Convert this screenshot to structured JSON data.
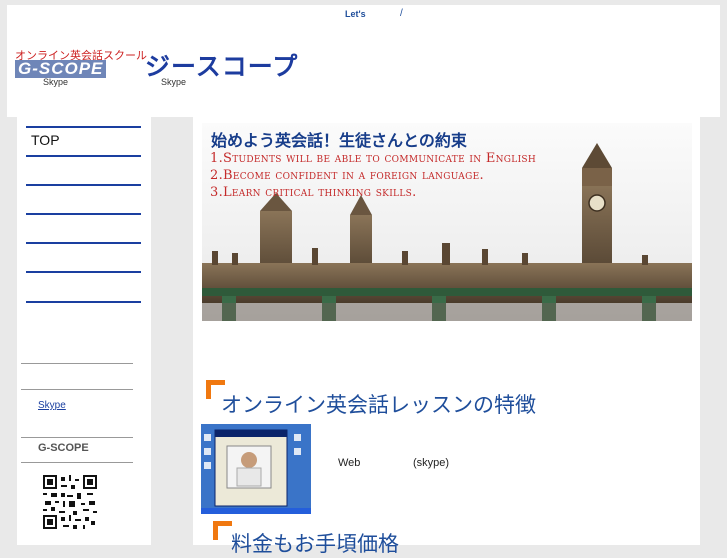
{
  "header": {
    "top_link": "Let's",
    "top_slash": "/",
    "logo1_jp": "オンライン英会話スクール",
    "logo1_en": "G-SCOPE",
    "logo1_sub": "Skype",
    "logo2": "ジースコープ",
    "logo2_sub": "Skype"
  },
  "sidebar": {
    "nav_items": [
      {
        "label": "TOP"
      },
      {
        "label": ""
      },
      {
        "label": ""
      },
      {
        "label": ""
      },
      {
        "label": ""
      },
      {
        "label": ""
      }
    ],
    "skype_link": "Skype",
    "brand": "G-SCOPE"
  },
  "banner": {
    "title": "始めよう英会話！生徒さんとの約束",
    "lines": [
      "1.Students will be able to communicate in English",
      "2.Become confident in a foreign language.",
      "3.Learn critical thinking skills."
    ]
  },
  "sections": {
    "features_heading": "オンライン英会話レッスンの特徴",
    "features_web": "Web",
    "features_skype": "(skype)",
    "price_heading": "料金もお手頃価格"
  },
  "colors": {
    "accent_blue": "#1a3fa0",
    "accent_orange": "#f07810",
    "banner_red": "#c42a2a"
  }
}
